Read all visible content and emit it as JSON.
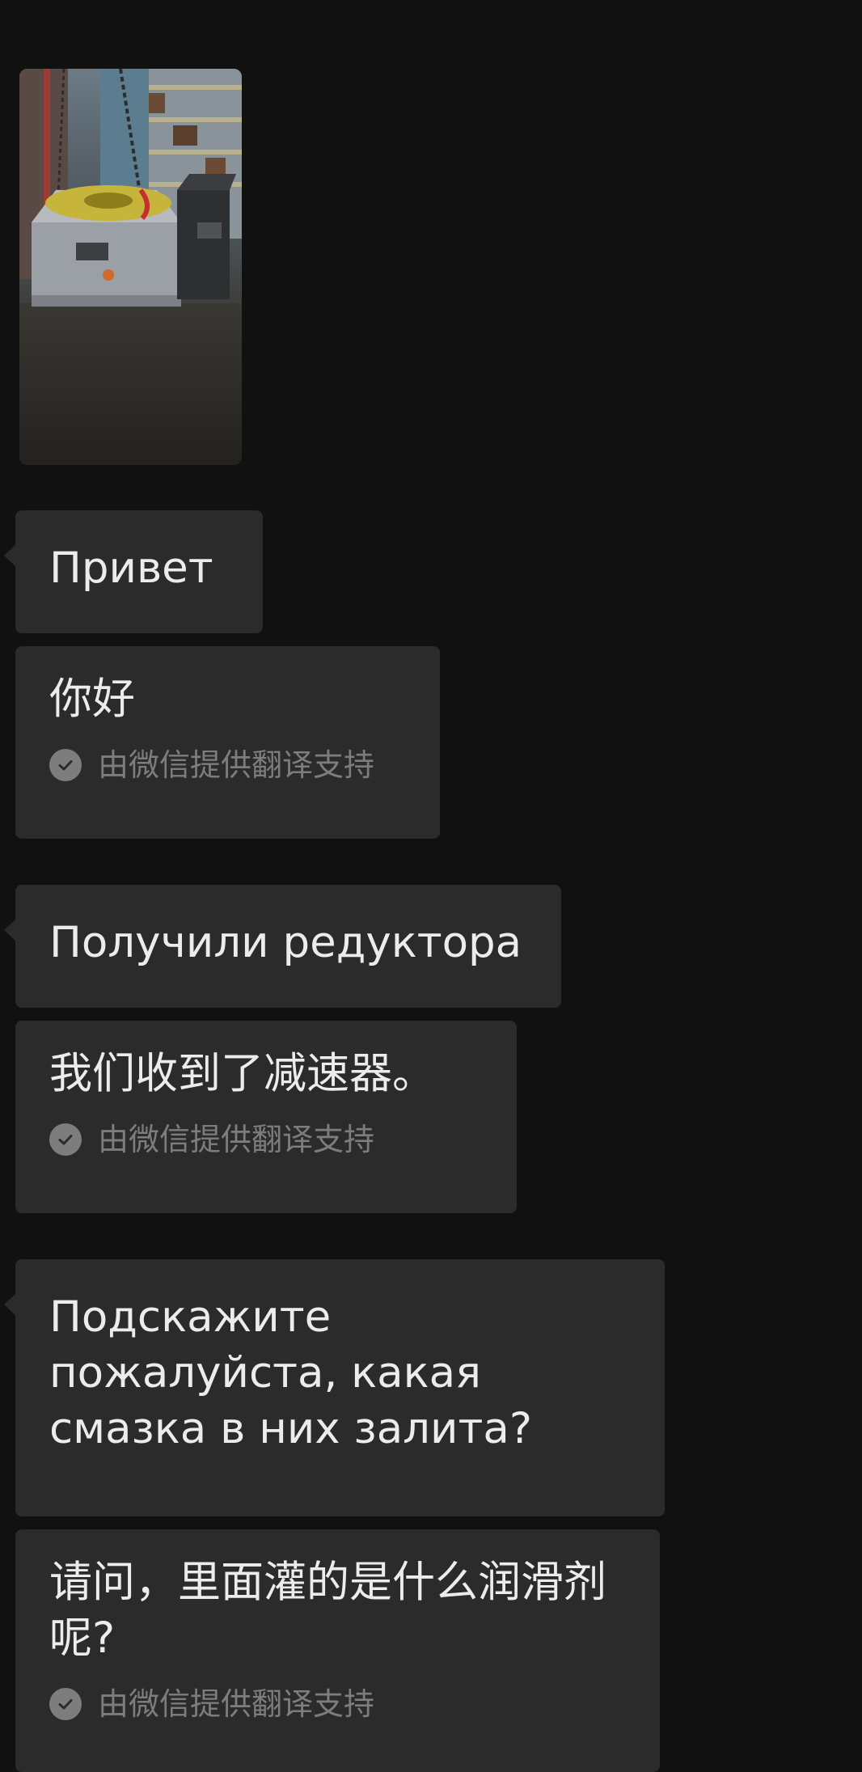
{
  "image_message": {
    "icon": "photo-thumbnail"
  },
  "messages": [
    {
      "original": "Привет",
      "translation": "你好",
      "translation_note": "由微信提供翻译支持"
    },
    {
      "original": "Получили редуктора",
      "translation": "我们收到了减速器。",
      "translation_note": "由微信提供翻译支持"
    },
    {
      "original": "Подскажите пожалуйста, какая смазка в них залита?",
      "translation": "请问，里面灌的是什么润滑剂呢?",
      "translation_note": "由微信提供翻译支持"
    }
  ],
  "colors": {
    "background": "#111111",
    "bubble": "#2b2b2b",
    "text": "#ececec",
    "note": "#7d7d7d"
  }
}
